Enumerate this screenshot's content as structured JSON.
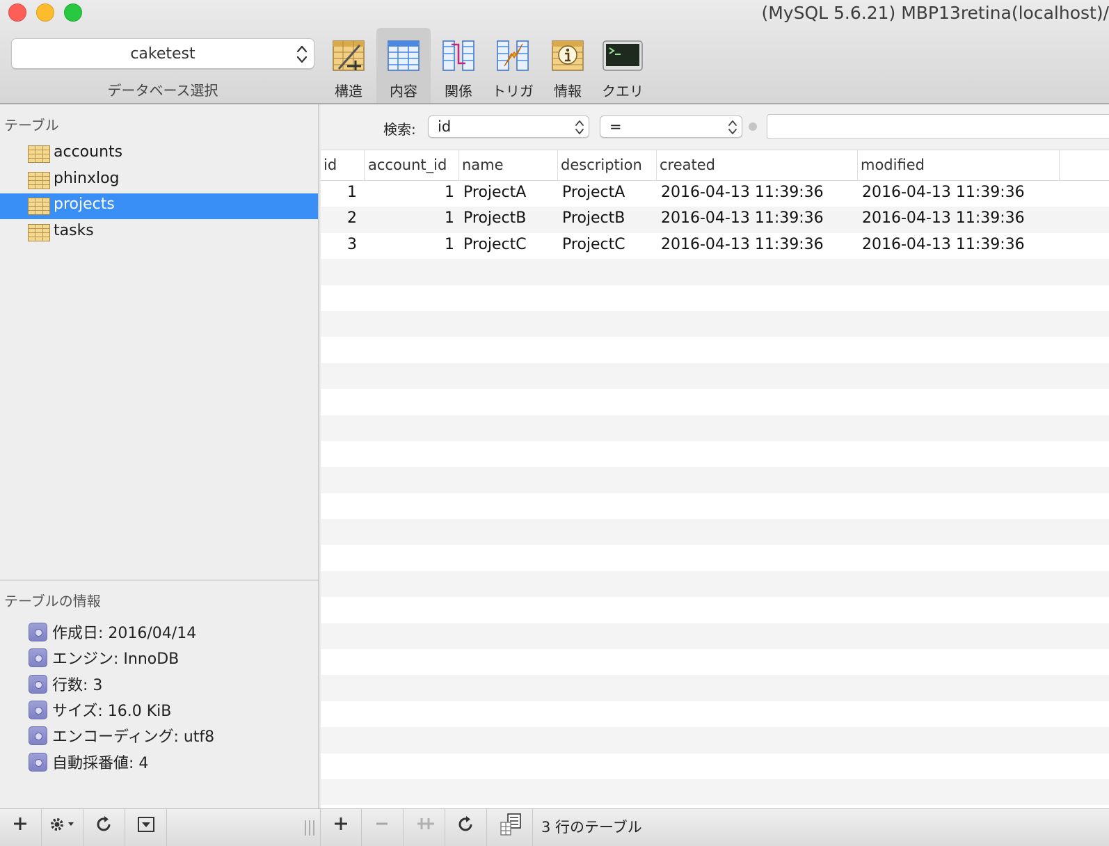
{
  "window": {
    "title": "(MySQL 5.6.21) MBP13retina(localhost)/"
  },
  "toolbar": {
    "database_select": {
      "value": "caketest",
      "caption": "データベース選択"
    },
    "buttons": [
      {
        "label": "構造",
        "icon": "structure-icon",
        "active": false
      },
      {
        "label": "内容",
        "icon": "content-icon",
        "active": true
      },
      {
        "label": "関係",
        "icon": "relations-icon",
        "active": false
      },
      {
        "label": "トリガ",
        "icon": "triggers-icon",
        "active": false
      },
      {
        "label": "情報",
        "icon": "info-icon",
        "active": false
      },
      {
        "label": "クエリ",
        "icon": "terminal-icon",
        "active": false
      }
    ]
  },
  "sidebar": {
    "tables_heading": "テーブル",
    "tables": [
      {
        "name": "accounts",
        "selected": false
      },
      {
        "name": "phinxlog",
        "selected": false
      },
      {
        "name": "projects",
        "selected": true
      },
      {
        "name": "tasks",
        "selected": false
      }
    ],
    "info_heading": "テーブルの情報",
    "info": [
      "作成日: 2016/04/14",
      "エンジン: InnoDB",
      "行数: 3",
      "サイズ: 16.0 KiB",
      "エンコーディング: utf8",
      "自動採番値: 4"
    ]
  },
  "filter": {
    "label": "検索:",
    "field": "id",
    "operator": "=",
    "value": ""
  },
  "grid": {
    "columns": [
      "id",
      "account_id",
      "name",
      "description",
      "created",
      "modified"
    ],
    "rows": [
      [
        "1",
        "1",
        "ProjectA",
        "ProjectA",
        "2016-04-13 11:39:36",
        "2016-04-13 11:39:36"
      ],
      [
        "2",
        "1",
        "ProjectB",
        "ProjectB",
        "2016-04-13 11:39:36",
        "2016-04-13 11:39:36"
      ],
      [
        "3",
        "1",
        "ProjectC",
        "ProjectC",
        "2016-04-13 11:39:36",
        "2016-04-13 11:39:36"
      ]
    ]
  },
  "status": {
    "text": "3 行のテーブル"
  },
  "colors": {
    "selection": "#3a8ff6",
    "close": "#fc5f57",
    "minimize": "#fdbc2e",
    "maximize": "#28c840"
  }
}
